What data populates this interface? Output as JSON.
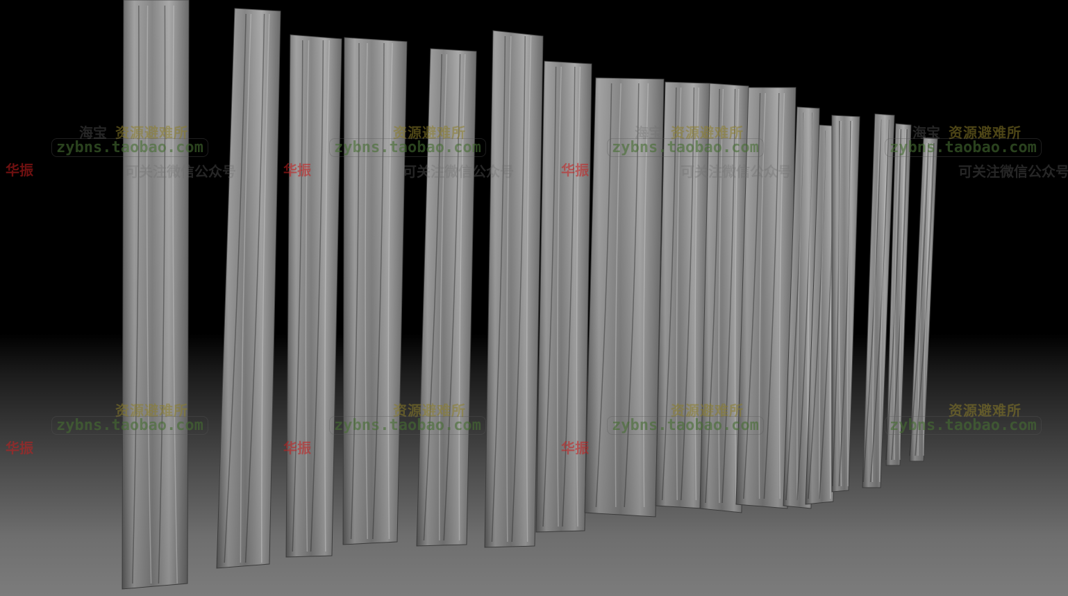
{
  "scene": {
    "subject": "sculpted wooden planks",
    "plank_count": 18,
    "colors": {
      "background_top": "#000000",
      "floor": "#7c7c7c",
      "plank_base": "#8e8e8e",
      "plank_shadow": "#4e4e4e",
      "plank_highlight": "#c4c4c4"
    }
  },
  "watermark": {
    "site_cn": "资源避难所",
    "site_cn_prefix": "海宝",
    "url": "zybns.taobao.com",
    "mark_red": "华振",
    "note_cn": "可关注微信公众号"
  }
}
